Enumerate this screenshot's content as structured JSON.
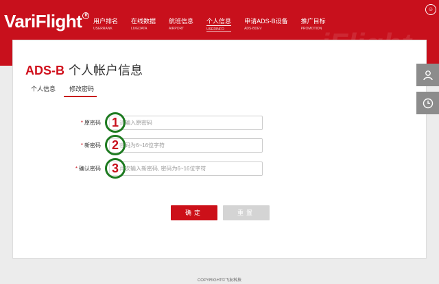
{
  "header": {
    "logo_text": "VariFlight",
    "logo_reg": "R",
    "watermark": "iFlight",
    "nav": [
      {
        "zh": "用户排名",
        "en": "USERRANK"
      },
      {
        "zh": "在线数据",
        "en": "LIVEDATA"
      },
      {
        "zh": "航班信息",
        "en": "AIRPORT"
      },
      {
        "zh": "个人信息",
        "en": "USERINFO"
      },
      {
        "zh": "申请ADS-B设备",
        "en": "ADS-BDEV"
      },
      {
        "zh": "推广目标",
        "en": "PROMOTION"
      }
    ],
    "corner_icon": "☺"
  },
  "page": {
    "title_brand": "ADS-B",
    "title_text": "个人帐户信息",
    "tabs": [
      "个人信息",
      "修改密码"
    ]
  },
  "form": {
    "fields": [
      {
        "label": "原密码",
        "placeholder": "请输入原密码",
        "marker": "1"
      },
      {
        "label": "新密码",
        "placeholder": "密码为6~16位字符",
        "marker": "2"
      },
      {
        "label": "确认密码",
        "placeholder": "再次输入新密码, 密码为6~16位字符",
        "marker": "3"
      }
    ],
    "required_mark": "*",
    "confirm_label": "确定",
    "reset_label": "重置"
  },
  "side": {
    "user_icon": "user-icon",
    "history_icon": "clock-icon"
  },
  "footer": {
    "text": "COPYRIGHT©飞友科技"
  }
}
